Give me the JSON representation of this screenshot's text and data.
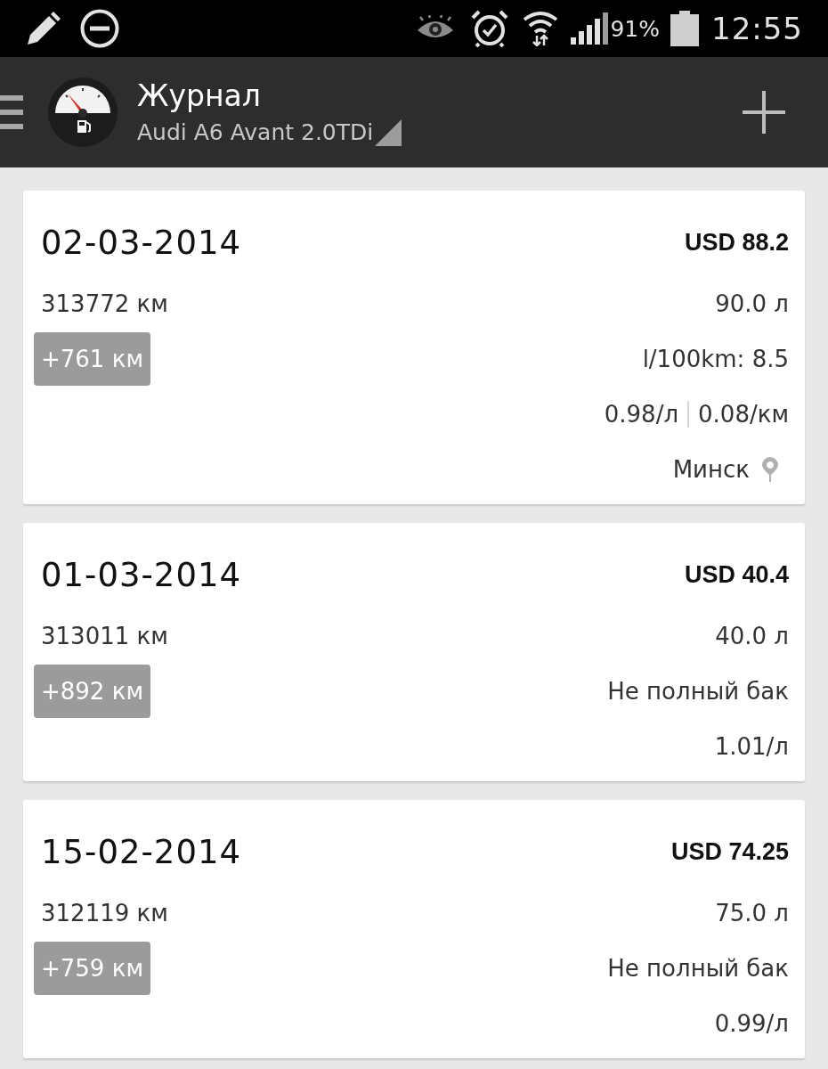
{
  "status_bar": {
    "battery": "91%",
    "time": "12:55"
  },
  "app_bar": {
    "title": "Журнал",
    "subtitle": "Audi A6 Avant 2.0TDi"
  },
  "entries": [
    {
      "date": "02-03-2014",
      "amount": "USD 88.2",
      "odometer": "313772 км",
      "volume": "90.0 л",
      "distance": "+761 км",
      "details": [
        {
          "kind": "consumption",
          "text": "l/100km: 8.5"
        },
        {
          "kind": "prices",
          "values": [
            "0.98/л",
            "0.08/км"
          ]
        },
        {
          "kind": "location",
          "text": "Минск"
        }
      ]
    },
    {
      "date": "01-03-2014",
      "amount": "USD 40.4",
      "odometer": "313011 км",
      "volume": "40.0 л",
      "distance": "+892 км",
      "details": [
        {
          "kind": "note",
          "text": "Не полный бак"
        },
        {
          "kind": "prices",
          "values": [
            "1.01/л"
          ]
        }
      ]
    },
    {
      "date": "15-02-2014",
      "amount": "USD 74.25",
      "odometer": "312119 км",
      "volume": "75.0 л",
      "distance": "+759 км",
      "details": [
        {
          "kind": "note",
          "text": "Не полный бак"
        },
        {
          "kind": "prices",
          "values": [
            "0.99/л"
          ]
        }
      ]
    }
  ]
}
